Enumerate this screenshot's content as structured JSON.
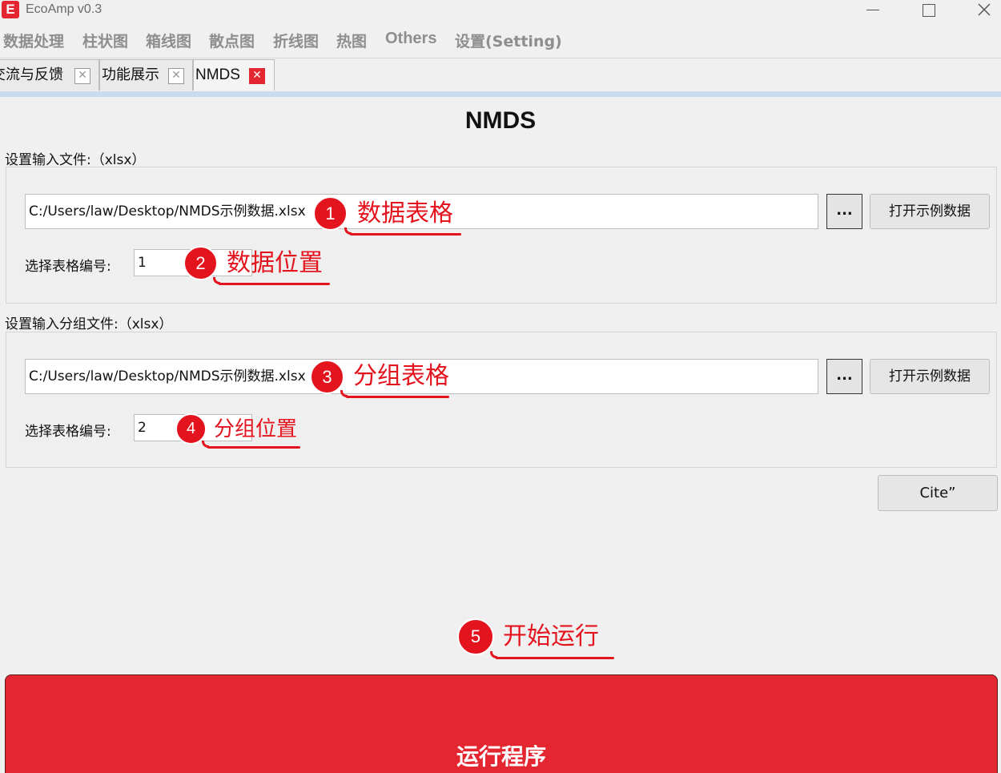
{
  "window": {
    "logo": "E",
    "title": "EcoAmp v0.3",
    "controls": [
      "minimize-icon",
      "maximize-icon",
      "close-icon"
    ]
  },
  "menu": [
    "数据处理",
    "柱状图",
    "箱线图",
    "散点图",
    "折线图",
    "热图",
    "Others",
    "设置(Setting)"
  ],
  "tabs": [
    {
      "label": "交流与反馈",
      "close": "✕"
    },
    {
      "label": "功能展示",
      "close": "✕"
    },
    {
      "label": "NMDS",
      "close": "✕"
    }
  ],
  "page_title": "NMDS",
  "input_file": {
    "section_label": "设置输入文件:（xlsx）",
    "path": "C:/Users/law/Desktop/NMDS示例数据.xlsx",
    "browse_label": "...",
    "sample_label": "打开示例数据",
    "sheet_label": "选择表格编号:",
    "sheet_value": "1"
  },
  "group_file": {
    "section_label": "设置输入分组文件:（xlsx）",
    "path": "C:/Users/law/Desktop/NMDS示例数据.xlsx",
    "browse_label": "...",
    "sample_label": "打开示例数据",
    "sheet_label": "选择表格编号:",
    "sheet_value": "2"
  },
  "cite_label": "Cite”",
  "run_label": "运行程序",
  "annotations": [
    {
      "num": "1",
      "text": "数据表格"
    },
    {
      "num": "2",
      "text": "数据位置"
    },
    {
      "num": "3",
      "text": "分组表格"
    },
    {
      "num": "4",
      "text": "分组位置"
    },
    {
      "num": "5",
      "text": "开始运行"
    }
  ],
  "colors": {
    "accent": "#e3262f",
    "annotation": "#e3141e",
    "tab_strip": "#c9dcef"
  }
}
